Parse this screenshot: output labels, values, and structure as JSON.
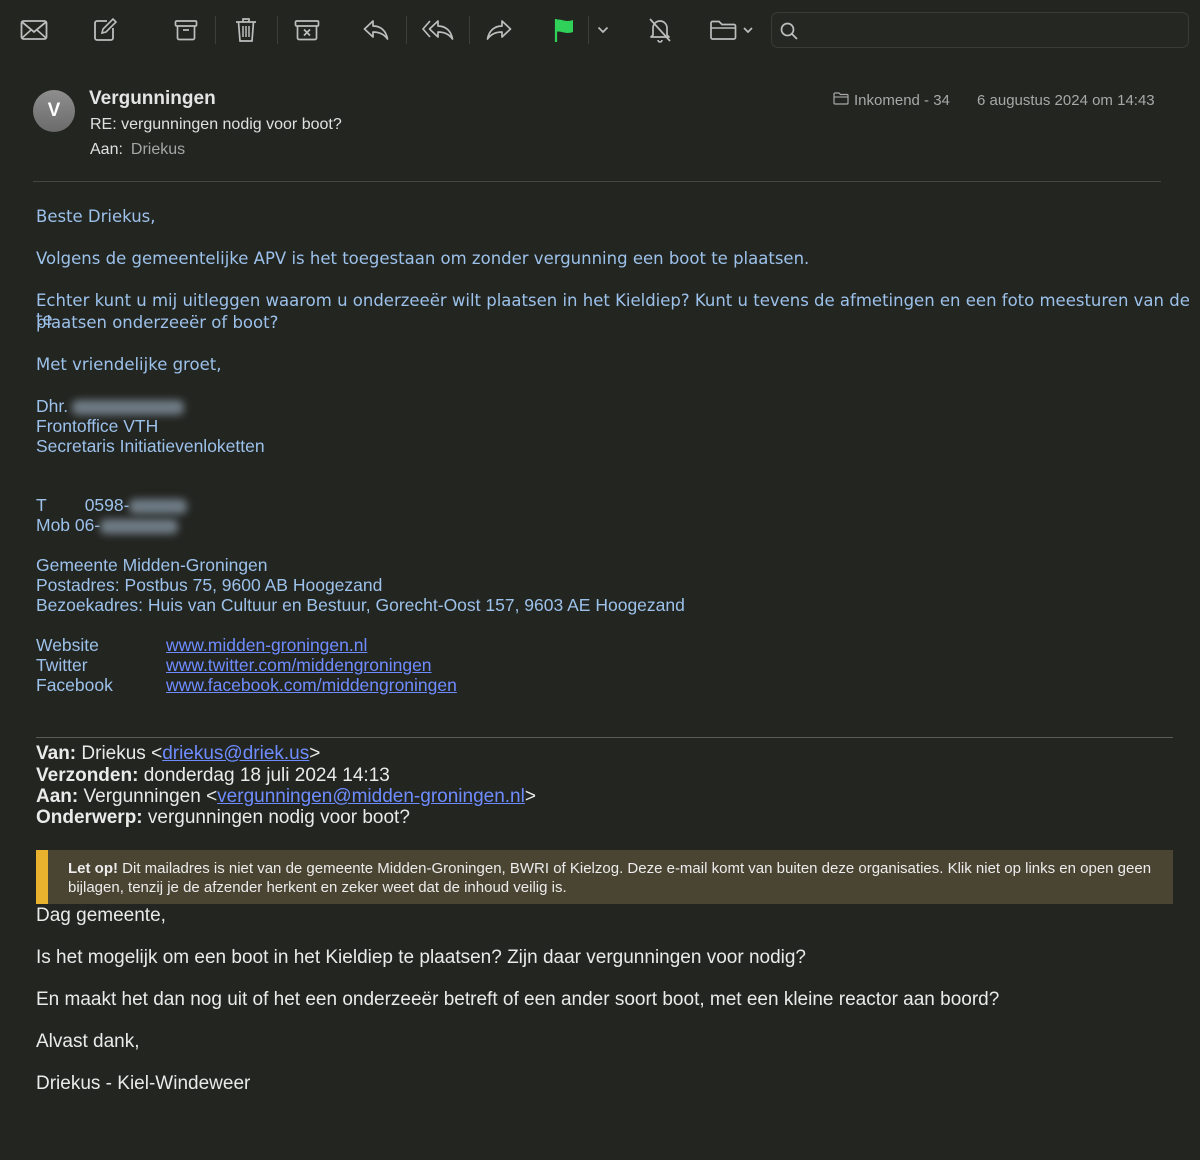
{
  "toolbar": {
    "search_placeholder": "",
    "icons": [
      "mail-icon",
      "compose-icon",
      "archive-icon",
      "trash-icon",
      "junk-icon",
      "reply-icon",
      "reply-all-icon",
      "forward-icon",
      "flag-icon",
      "chevron-down-icon",
      "mute-bell-icon",
      "folder-icon",
      "search-icon"
    ],
    "flag_color": "#30d158"
  },
  "header": {
    "avatar_initial": "V",
    "sender": "Vergunningen",
    "subject": "RE: vergunningen nodig voor boot?",
    "to_label": "Aan:",
    "to_value": "Driekus",
    "mailbox": "Inkomend - 34",
    "date": "6 augustus 2024 om 14:43"
  },
  "reply": {
    "greeting": "Beste Driekus,",
    "p1": "Volgens de gemeentelijke APV is het toegestaan om zonder vergunning een boot te plaatsen.",
    "p2_line1": "Echter kunt u mij uitleggen waarom u onderzeeër wilt plaatsen in het Kieldiep? Kunt u tevens de afmetingen en een foto meesturen van de te",
    "p2_line2": "plaatsen onderzeeër of boot?",
    "closing": "Met vriendelijke groet,",
    "sig_name_prefix": "Dhr.",
    "sig_role1": "Frontoffice VTH",
    "sig_role2": "Secretaris Initiatievenloketten",
    "phone_label": "T",
    "phone_prefix": "0598-",
    "mobile_label": "Mob 06-",
    "org": "Gemeente Midden-Groningen",
    "postal": "Postadres: Postbus 75, 9600 AB Hoogezand",
    "visit": "Bezoekadres: Huis van Cultuur en Bestuur, Gorecht-Oost 157, 9603 AE Hoogezand",
    "links": [
      {
        "label": "Website",
        "url": "www.midden-groningen.nl"
      },
      {
        "label": "Twitter",
        "url": "www.twitter.com/middengroningen"
      },
      {
        "label": "Facebook",
        "url": "www.facebook.com/middengroningen"
      }
    ]
  },
  "quoted": {
    "from_label": "Van:",
    "from_name": "Driekus <",
    "from_email": "driekus@driek.us",
    "from_end": ">",
    "sent_label": "Verzonden:",
    "sent_value": "donderdag 18 juli 2024 14:13",
    "to_label": "Aan:",
    "to_name": "Vergunningen <",
    "to_email": "vergunningen@midden-groningen.nl",
    "to_end": ">",
    "subject_label": "Onderwerp:",
    "subject_value": "vergunningen nodig voor boot?",
    "warning_bold": "Let op!",
    "warning_text": " Dit mailadres is niet van de gemeente Midden-Groningen, BWRI of Kielzog. Deze e-mail komt van buiten deze organisaties. Klik niet op links en open geen bijlagen, tenzij je de afzender herkent en zeker weet dat de inhoud veilig is.",
    "body": [
      "Dag gemeente,",
      "Is het mogelijk om een boot in het Kieldiep te plaatsen? Zijn daar vergunningen voor nodig?",
      "En maakt het dan nog uit of het een onderzeeër betreft of een ander soort boot, met een kleine reactor aan boord?",
      "Alvast dank,",
      "Driekus - Kiel-Windeweer"
    ]
  }
}
